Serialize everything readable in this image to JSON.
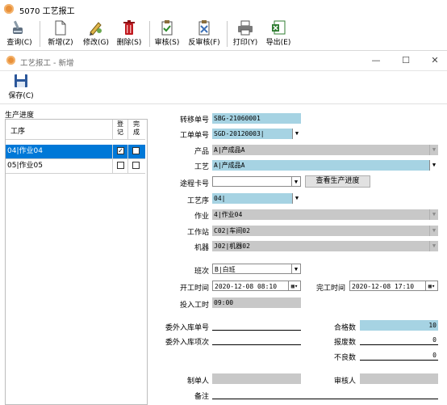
{
  "window": {
    "title": "5070 工艺报工"
  },
  "toolbar": {
    "query": "查询(C)",
    "add": "新增(Z)",
    "edit": "修改(G)",
    "delete": "删除(S)",
    "audit": "审核(S)",
    "unaudit": "反审核(F)",
    "print": "打印(Y)",
    "export": "导出(E)"
  },
  "form": {
    "title": "工艺报工 - 新增",
    "save_label": "保存(C)",
    "controls": {
      "minimize": "—",
      "maximize": "☐",
      "close": "✕"
    }
  },
  "progress": {
    "group_label": "生产进度",
    "headers": {
      "process": "工序",
      "registered": "登记",
      "completed": "完成"
    },
    "rows": [
      {
        "process": "04|作业04",
        "registered": "✓",
        "completed": "",
        "selected": true
      },
      {
        "process": "05|作业05",
        "registered": "",
        "completed": "",
        "selected": false
      }
    ]
  },
  "fields": {
    "transfer_no": {
      "label": "转移单号",
      "value": "SBG-21060001"
    },
    "work_order": {
      "label": "工单单号",
      "value": "SGD-20120003|"
    },
    "product": {
      "label": "产品",
      "value": "A|产成品A"
    },
    "craft": {
      "label": "工艺",
      "value": "A|产成品A"
    },
    "route_card": {
      "label": "途程卡号",
      "value": ""
    },
    "view_progress_button": "查看生产进度",
    "sequence": {
      "label": "工艺序",
      "value": "04|"
    },
    "operation": {
      "label": "作业",
      "value": "4|作业04"
    },
    "workstation": {
      "label": "工作站",
      "value": "C02|车间02"
    },
    "machine": {
      "label": "机器",
      "value": "J02|机器02"
    },
    "shift": {
      "label": "班次",
      "value": "B|白班"
    },
    "start_time": {
      "label": "开工时间",
      "value": "2020-12-08 08:10"
    },
    "end_time": {
      "label": "完工时间",
      "value": "2020-12-08 17:10"
    },
    "work_hours": {
      "label": "投入工时",
      "value": "09:00"
    },
    "outsource_no": {
      "label": "委外入库单号",
      "value": ""
    },
    "outsource_item": {
      "label": "委外入库项次",
      "value": ""
    },
    "qualified": {
      "label": "合格数",
      "value": "10"
    },
    "scrap": {
      "label": "报废数",
      "value": "0"
    },
    "defective": {
      "label": "不良数",
      "value": "0"
    },
    "creator": {
      "label": "制单人",
      "value": ""
    },
    "auditor": {
      "label": "审核人",
      "value": ""
    },
    "remark": {
      "label": "备注",
      "value": ""
    }
  },
  "colors": {
    "required": "#a6d3e3",
    "disabled": "#c8c8c8",
    "selection": "#0078d7"
  }
}
